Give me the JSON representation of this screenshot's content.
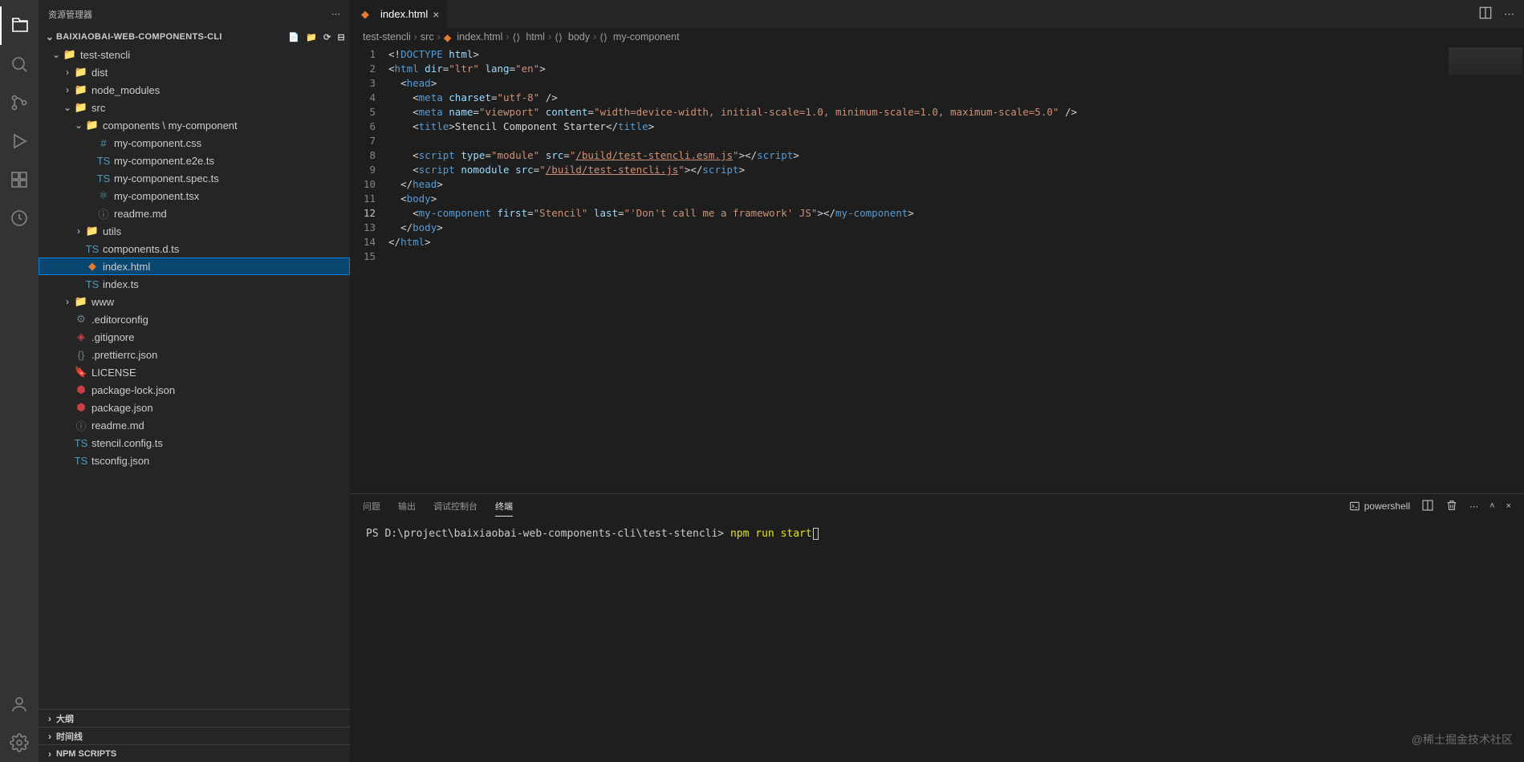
{
  "sidebar_title": "资源管理器",
  "project_name": "BAIXIAOBAI-WEB-COMPONENTS-CLI",
  "tree": {
    "test_stencli": "test-stencli",
    "dist": "dist",
    "node_modules": "node_modules",
    "src": "src",
    "components_path": "components \\ my-component",
    "my_component_css": "my-component.css",
    "my_component_e2e": "my-component.e2e.ts",
    "my_component_spec": "my-component.spec.ts",
    "my_component_tsx": "my-component.tsx",
    "readme_md_inner": "readme.md",
    "utils": "utils",
    "components_dts": "components.d.ts",
    "index_html": "index.html",
    "index_ts": "index.ts",
    "www": "www",
    "editorconfig": ".editorconfig",
    "gitignore": ".gitignore",
    "prettierrc": ".prettierrc.json",
    "license": "LICENSE",
    "package_lock": "package-lock.json",
    "package_json": "package.json",
    "readme_md": "readme.md",
    "stencil_config": "stencil.config.ts",
    "tsconfig": "tsconfig.json"
  },
  "collapsed_sections": {
    "outline": "大纲",
    "timeline": "时间线",
    "npm_scripts": "NPM SCRIPTS"
  },
  "tab": {
    "file": "index.html"
  },
  "breadcrumbs": {
    "p0": "test-stencli",
    "p1": "src",
    "p2": "index.html",
    "p3": "html",
    "p4": "body",
    "p5": "my-component"
  },
  "editor": {
    "current_line_no": "12",
    "lines": [
      {
        "no": "1",
        "html": "<span class='tk-txt'>&lt;!</span><span class='tk-doctype'>DOCTYPE</span><span class='tk-txt'> </span><span class='tk-attr'>html</span><span class='tk-txt'>&gt;</span>"
      },
      {
        "no": "2",
        "html": "<span class='tk-txt'>&lt;</span><span class='tk-tag'>html</span> <span class='tk-attr'>dir</span><span class='tk-txt'>=</span><span class='tk-str'>\"ltr\"</span> <span class='tk-attr'>lang</span><span class='tk-txt'>=</span><span class='tk-str'>\"en\"</span><span class='tk-txt'>&gt;</span>"
      },
      {
        "no": "3",
        "html": "  <span class='tk-txt'>&lt;</span><span class='tk-tag'>head</span><span class='tk-txt'>&gt;</span>"
      },
      {
        "no": "4",
        "html": "    <span class='tk-txt'>&lt;</span><span class='tk-tag'>meta</span> <span class='tk-attr'>charset</span><span class='tk-txt'>=</span><span class='tk-str'>\"utf-8\"</span> <span class='tk-txt'>/&gt;</span>"
      },
      {
        "no": "5",
        "html": "    <span class='tk-txt'>&lt;</span><span class='tk-tag'>meta</span> <span class='tk-attr'>name</span><span class='tk-txt'>=</span><span class='tk-str'>\"viewport\"</span> <span class='tk-attr'>content</span><span class='tk-txt'>=</span><span class='tk-str'>\"width=device-width, initial-scale=1.0, minimum-scale=1.0, maximum-scale=5.0\"</span> <span class='tk-txt'>/&gt;</span>"
      },
      {
        "no": "6",
        "html": "    <span class='tk-txt'>&lt;</span><span class='tk-tag'>title</span><span class='tk-txt'>&gt;Stencil Component Starter&lt;/</span><span class='tk-tag'>title</span><span class='tk-txt'>&gt;</span>"
      },
      {
        "no": "7",
        "html": ""
      },
      {
        "no": "8",
        "html": "    <span class='tk-txt'>&lt;</span><span class='tk-tag'>script</span> <span class='tk-attr'>type</span><span class='tk-txt'>=</span><span class='tk-str'>\"module\"</span> <span class='tk-attr'>src</span><span class='tk-txt'>=</span><span class='tk-str'>\"</span><span class='tk-str tk-under'>/build/test-stencli.esm.js</span><span class='tk-str'>\"</span><span class='tk-txt'>&gt;&lt;/</span><span class='tk-tag'>script</span><span class='tk-txt'>&gt;</span>"
      },
      {
        "no": "9",
        "html": "    <span class='tk-txt'>&lt;</span><span class='tk-tag'>script</span> <span class='tk-attr'>nomodule</span> <span class='tk-attr'>src</span><span class='tk-txt'>=</span><span class='tk-str'>\"</span><span class='tk-str tk-under'>/build/test-stencli.js</span><span class='tk-str'>\"</span><span class='tk-txt'>&gt;&lt;/</span><span class='tk-tag'>script</span><span class='tk-txt'>&gt;</span>"
      },
      {
        "no": "10",
        "html": "  <span class='tk-txt'>&lt;/</span><span class='tk-tag'>head</span><span class='tk-txt'>&gt;</span>"
      },
      {
        "no": "11",
        "html": "  <span class='tk-txt'>&lt;</span><span class='tk-tag'>body</span><span class='tk-txt'>&gt;</span>"
      },
      {
        "no": "12",
        "html": "    <span class='tk-txt'>&lt;</span><span class='tk-tag'>my-component</span> <span class='tk-attr'>first</span><span class='tk-txt'>=</span><span class='tk-str'>\"Stencil\"</span> <span class='tk-attr'>last</span><span class='tk-txt'>=</span><span class='tk-str'>\"'Don't call me a framework' JS\"</span><span class='tk-txt'>&gt;&lt;/</span><span class='tk-tag'>my-component</span><span class='tk-txt'>&gt;</span>"
      },
      {
        "no": "13",
        "html": "  <span class='tk-txt'>&lt;/</span><span class='tk-tag'>body</span><span class='tk-txt'>&gt;</span>"
      },
      {
        "no": "14",
        "html": "<span class='tk-txt'>&lt;/</span><span class='tk-tag'>html</span><span class='tk-txt'>&gt;</span>"
      },
      {
        "no": "15",
        "html": ""
      }
    ]
  },
  "panel": {
    "tabs": {
      "problems": "问题",
      "output": "输出",
      "debug": "调试控制台",
      "terminal": "终端"
    },
    "shell": "powershell"
  },
  "terminal": {
    "prompt": "PS D:\\project\\baixiaobai-web-components-cli\\test-stencli> ",
    "cmd": "npm run start"
  },
  "watermark": "@稀土掘金技术社区"
}
